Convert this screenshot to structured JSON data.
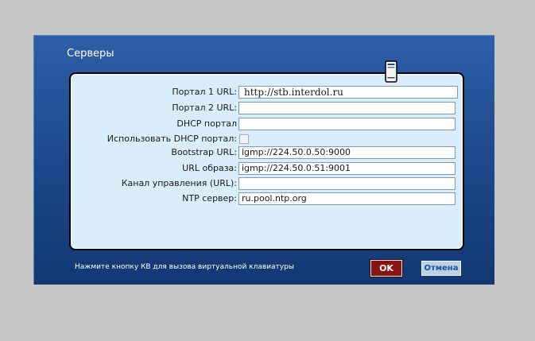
{
  "dialog": {
    "title": "Серверы"
  },
  "fields": [
    {
      "label": "Портал 1 URL:",
      "value": "http://stb.interdol.ru"
    },
    {
      "label": "Портал 2 URL:",
      "value": ""
    },
    {
      "label": "DHCP портал",
      "value": ""
    },
    {
      "label": "Использовать DHCP портал:",
      "checked": false
    },
    {
      "label": "Bootstrap URL:",
      "value": "igmp://224.50.0.50:9000"
    },
    {
      "label": "URL образа:",
      "value": "igmp://224.50.0.51:9001"
    },
    {
      "label": "Канал управления (URL):",
      "value": ""
    },
    {
      "label": "NTP сервер:",
      "value": "ru.pool.ntp.org"
    }
  ],
  "footer": {
    "hint": "Нажмите кнопку КВ для вызова виртуальной клавиатуры",
    "ok_label": "OK",
    "cancel_label": "Отмена"
  },
  "icons": {
    "server": "server-icon"
  },
  "colors": {
    "dialog_bg": "#1f4a8f",
    "panel_bg": "#d9eefa",
    "ok_bg": "#8a1414",
    "cancel_text": "#1d4f95",
    "page_bg": "#c6c6c6"
  }
}
